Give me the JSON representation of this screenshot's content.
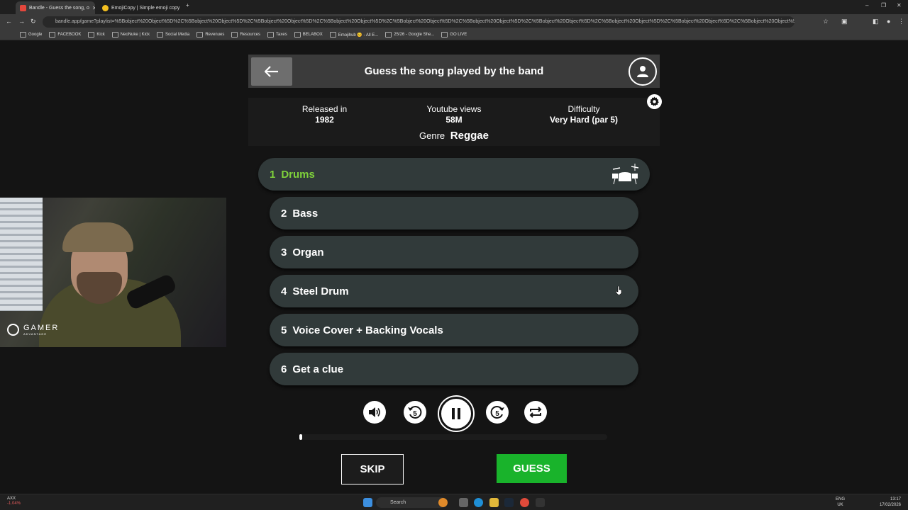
{
  "browser": {
    "tabs": [
      {
        "label": "Bandle - Guess the song, o",
        "active": true
      },
      {
        "label": "EmojiCopy | Simple emoji copy",
        "active": false
      }
    ],
    "url": "bandle.app/game?playlist=%5Bobject%20Object%5D%2C%5Bobject%20Object%5D%2C%5Bobject%20Object%5D%2C%5Bobject%20Object%5D%2C%5Bobject%20Object%5D%2C%5Bobject%20Object%5D%2C%5Bobject%20Object%5D%2C%5Bobject%20Object%5D%2C%5Bobject%20Object%5D%2C%5Bobject%20Object%5D%2C%5Bobject%20Object%5D%2C%5Bobject%20Object%5D%2C%5Bobject%20Object",
    "bookmarks": [
      "Google",
      "FACEBOOK",
      "Kick",
      "NeoNuke | Kick",
      "Social Media",
      "Revenues",
      "Resources",
      "Taxes",
      "BELABOX",
      "Emojihub 😊 - All E...",
      "25/26 - Google She...",
      "GO LIVE"
    ]
  },
  "header": {
    "title": "Guess the song played by the band"
  },
  "info": {
    "released_label": "Released in",
    "released_value": "1982",
    "views_label": "Youtube views",
    "views_value": "58M",
    "difficulty_label": "Difficulty",
    "difficulty_value": "Very Hard (par 5)",
    "genre_label": "Genre",
    "genre_value": "Reggae"
  },
  "tracks": [
    {
      "num": "1",
      "label": "Drums",
      "active": true
    },
    {
      "num": "2",
      "label": "Bass"
    },
    {
      "num": "3",
      "label": "Organ"
    },
    {
      "num": "4",
      "label": "Steel Drum"
    },
    {
      "num": "5",
      "label": "Voice Cover + Backing Vocals"
    },
    {
      "num": "6",
      "label": "Get a clue"
    }
  ],
  "controls": {
    "icons": [
      "volume-icon",
      "rewind-5-icon",
      "pause-icon",
      "forward-5-icon",
      "repeat-icon"
    ],
    "rewind_seconds": "5",
    "forward_seconds": "5",
    "progress_fraction": 0
  },
  "actions": {
    "skip_label": "SKIP",
    "guess_label": "GUESS"
  },
  "webcam": {
    "brand": "GAMER",
    "brand_sub": "ADVANTAGE"
  },
  "taskbar": {
    "ticker_symbol": "AXX",
    "ticker_change": "-1.04%",
    "search_placeholder": "Search",
    "lang_top": "ENG",
    "lang_bottom": "UK",
    "time": "13:17",
    "date": "17/02/2026"
  },
  "colors": {
    "active_track": "#7fd13b",
    "guess_button": "#19b32b",
    "track_bg": "#313a3a"
  }
}
